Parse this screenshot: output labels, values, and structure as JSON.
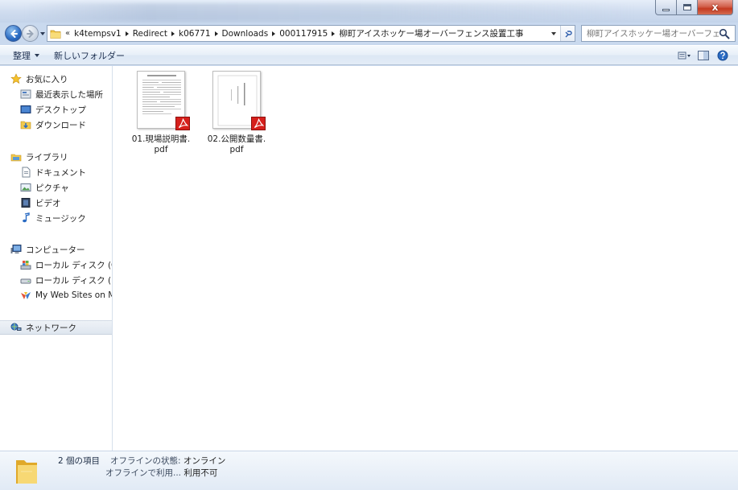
{
  "window": {
    "minimize_glyph": "",
    "close_glyph": "x"
  },
  "address": {
    "overflow": "«",
    "crumbs": [
      "k4tempsv1",
      "Redirect",
      "k06771",
      "Downloads",
      "000117915",
      "柳町アイスホッケー場オーバーフェンス設置工事"
    ]
  },
  "search": {
    "placeholder": "柳町アイスホッケー場オーバーフェ..."
  },
  "toolbar": {
    "organize": "整理",
    "new_folder": "新しいフォルダー"
  },
  "sidebar": {
    "favorites": {
      "label": "お気に入り",
      "items": [
        "最近表示した場所",
        "デスクトップ",
        "ダウンロード"
      ]
    },
    "libraries": {
      "label": "ライブラリ",
      "items": [
        "ドキュメント",
        "ピクチャ",
        "ビデオ",
        "ミュージック"
      ]
    },
    "computer": {
      "label": "コンピューター",
      "items": [
        "ローカル ディスク (C",
        "ローカル ディスク (D",
        "My Web Sites on MS"
      ]
    },
    "network": {
      "label": "ネットワーク"
    }
  },
  "files": [
    {
      "line1": "01.現場説明書.",
      "line2": "pdf"
    },
    {
      "line1": "02.公開数量書.",
      "line2": "pdf"
    }
  ],
  "details": {
    "count": "2 個の項目",
    "offline_label": "オフラインの状態:",
    "offline_value": "オンライン",
    "avail_label": "オフラインで利用...",
    "avail_value": "利用不可"
  },
  "colors": {
    "accent": "#2a6bc3",
    "pdf_red": "#d6201c",
    "folder": "#f2c94c"
  }
}
